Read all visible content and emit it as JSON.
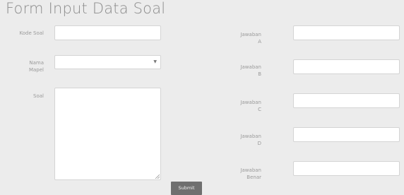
{
  "form": {
    "title": "Form Input Data Soal",
    "kode_soal": {
      "label": "Kode Soal",
      "value": ""
    },
    "nama_mapel": {
      "label_line1": "Nama",
      "label_line2": "Mapel",
      "selected": ""
    },
    "soal": {
      "label": "Soal",
      "value": ""
    },
    "jawaban_a": {
      "label_line1": "Jawaban",
      "label_line2": "A",
      "value": ""
    },
    "jawaban_b": {
      "label_line1": "Jawaban",
      "label_line2": "B",
      "value": ""
    },
    "jawaban_c": {
      "label_line1": "Jawaban",
      "label_line2": "C",
      "value": ""
    },
    "jawaban_d": {
      "label_line1": "Jawaban",
      "label_line2": "D",
      "value": ""
    },
    "jawaban_benar": {
      "label_line1": "Jawaban",
      "label_line2": "Benar",
      "value": ""
    },
    "submit_label": "Submit"
  },
  "icons": {
    "select_arrow": "chevron-down-icon",
    "resize": "resize-grip-icon"
  }
}
